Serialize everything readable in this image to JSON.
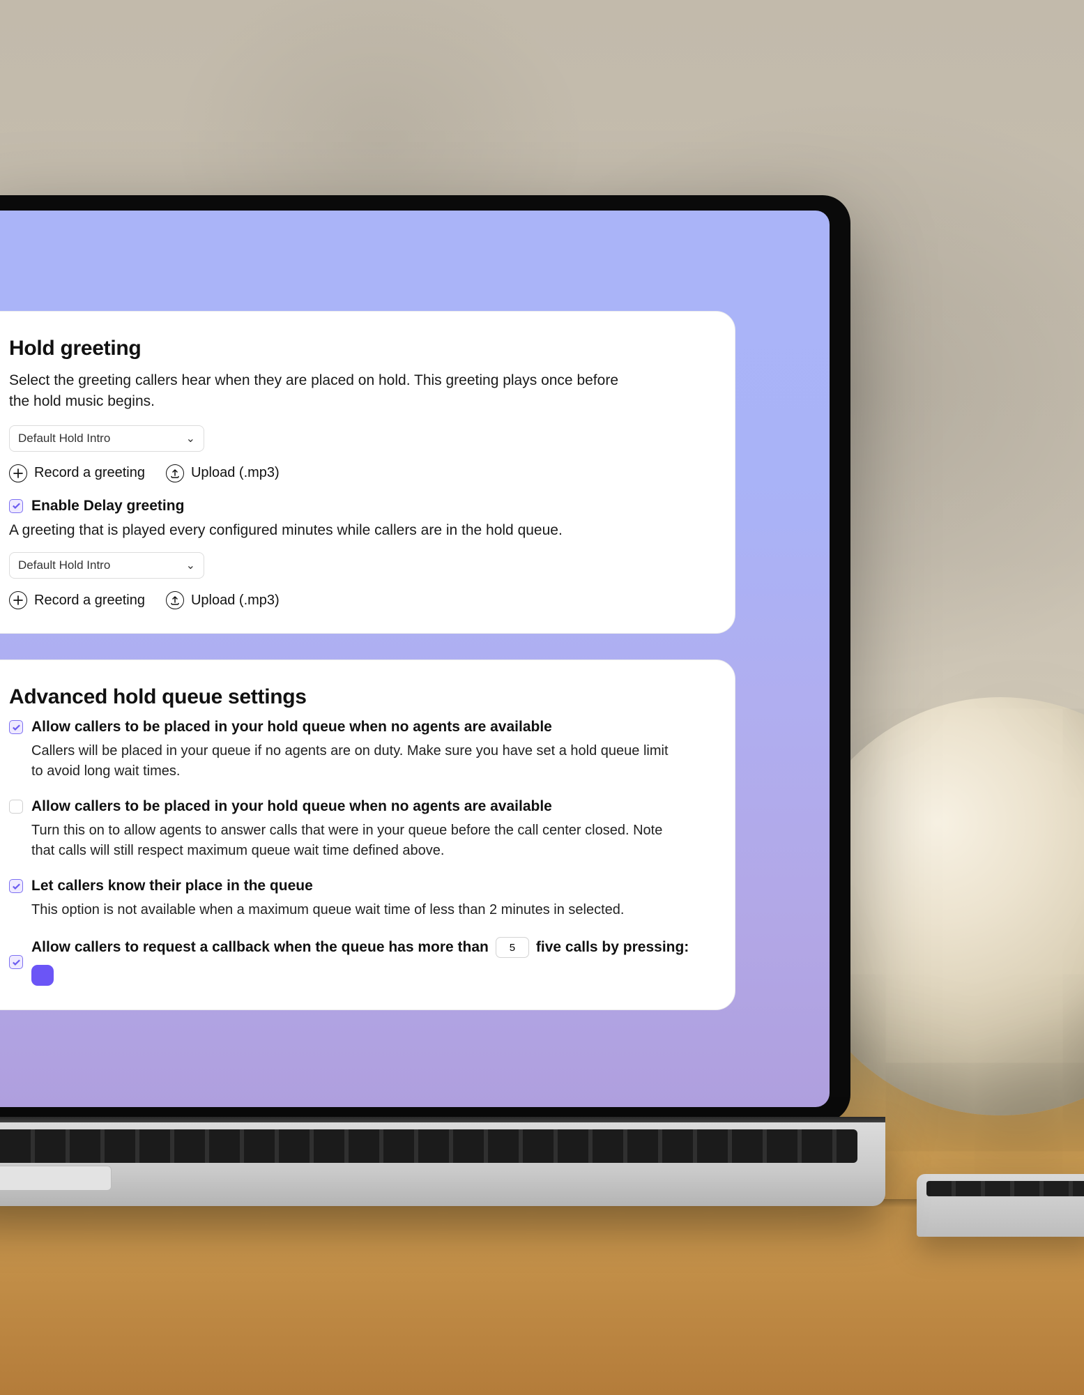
{
  "holdGreeting": {
    "title": "Hold greeting",
    "description": "Select the greeting callers hear when they are placed on hold. This greeting plays once before the hold music begins.",
    "select1": "Default Hold Intro",
    "recordLabel": "Record a greeting",
    "uploadLabel": "Upload (.mp3)",
    "enableDelayLabel": "Enable Delay greeting",
    "delayDescription": "A greeting that is played every configured minutes while callers are in the hold queue.",
    "select2": "Default Hold Intro"
  },
  "advanced": {
    "title": "Advanced hold queue settings",
    "opt1": {
      "label": "Allow callers to be placed in your hold queue when no agents are available",
      "sub": "Callers will be placed in your queue if no agents are on duty. Make sure you have set a hold queue limit to avoid long wait times."
    },
    "opt2": {
      "label": "Allow callers to be placed in your hold queue when no agents are available",
      "sub": "Turn this on to allow agents to answer calls that were in your queue before the call center closed. Note that calls will still respect maximum queue wait time defined above."
    },
    "opt3": {
      "label": "Let callers know their place in the queue",
      "sub": "This option is not available when a maximum queue wait time of less than 2 minutes in selected."
    },
    "opt4": {
      "labelPre": "Allow callers to request a callback when the queue has more than",
      "value": "5",
      "labelPost": "five calls by pressing:"
    }
  }
}
